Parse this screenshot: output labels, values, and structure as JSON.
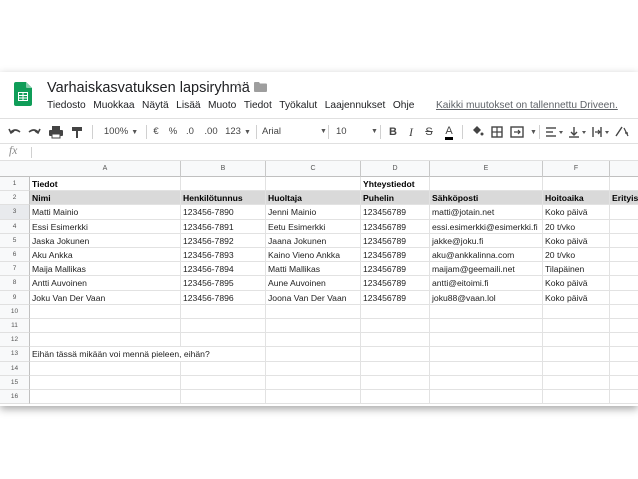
{
  "doc": {
    "title": "Varhaiskasvatuksen lapsiryhmä",
    "save_status": "Kaikki muutokset on tallennettu Driveen."
  },
  "menu": [
    "Tiedosto",
    "Muokkaa",
    "Näytä",
    "Lisää",
    "Muoto",
    "Tiedot",
    "Työkalut",
    "Laajennukset",
    "Ohje"
  ],
  "toolbar": {
    "zoom": "100%",
    "currency": "€",
    "percent": "%",
    "decimal_less": ".0",
    "decimal_more": ".00",
    "more_formats": "123",
    "font": "Arial",
    "font_size": "10",
    "bold": "B",
    "italic": "I",
    "strike": "S",
    "text_color": "A"
  },
  "formula_bar": {
    "icon": "fx",
    "value": ""
  },
  "columns": [
    "A",
    "B",
    "C",
    "D",
    "E",
    "F"
  ],
  "section_row": {
    "a": "Tiedot",
    "d": "Yhteystiedot"
  },
  "header_row": [
    "Nimi",
    "Henkilötunnus",
    "Huoltaja",
    "Puhelin",
    "Sähköposti",
    "Hoitoaika",
    "Erityis"
  ],
  "data_rows": [
    [
      "Matti Mainio",
      "123456-7890",
      "Jenni Mainio",
      "123456789",
      "matti@jotain.net",
      "Koko päivä"
    ],
    [
      "Essi Esimerkki",
      "123456-7891",
      "Eetu Esimerkki",
      "123456789",
      "essi.esimerkki@esimerkki.fi",
      "20 t/vko"
    ],
    [
      "Jaska Jokunen",
      "123456-7892",
      "Jaana Jokunen",
      "123456789",
      "jakke@joku.fi",
      "Koko päivä"
    ],
    [
      "Aku Ankka",
      "123456-7893",
      "Kaino Vieno Ankka",
      "123456789",
      "aku@ankkalinna.com",
      "20 t/vko"
    ],
    [
      "Maija Mallikas",
      "123456-7894",
      "Matti Mallikas",
      "123456789",
      "maijam@geemaili.net",
      "Tilapäinen"
    ],
    [
      "Antti Auvoinen",
      "123456-7895",
      "Aune Auvoinen",
      "123456789",
      "antti@eitoimi.fi",
      "Koko päivä"
    ],
    [
      "Joku Van Der Vaan",
      "123456-7896",
      "Joona Van Der Vaan",
      "123456789",
      "joku88@vaan.lol",
      "Koko päivä"
    ]
  ],
  "note_row": "Eihän tässä mikään voi mennä pieleen, eihän?",
  "row_numbers": [
    "1",
    "2",
    "3",
    "4",
    "5",
    "6",
    "7",
    "8",
    "9",
    "10",
    "11",
    "12",
    "13",
    "14",
    "15",
    "16"
  ],
  "colors": {
    "sheets_green": "#0f9d58",
    "header_fill": "#d9d9d9",
    "selected_row_header": "#e8eaed"
  }
}
